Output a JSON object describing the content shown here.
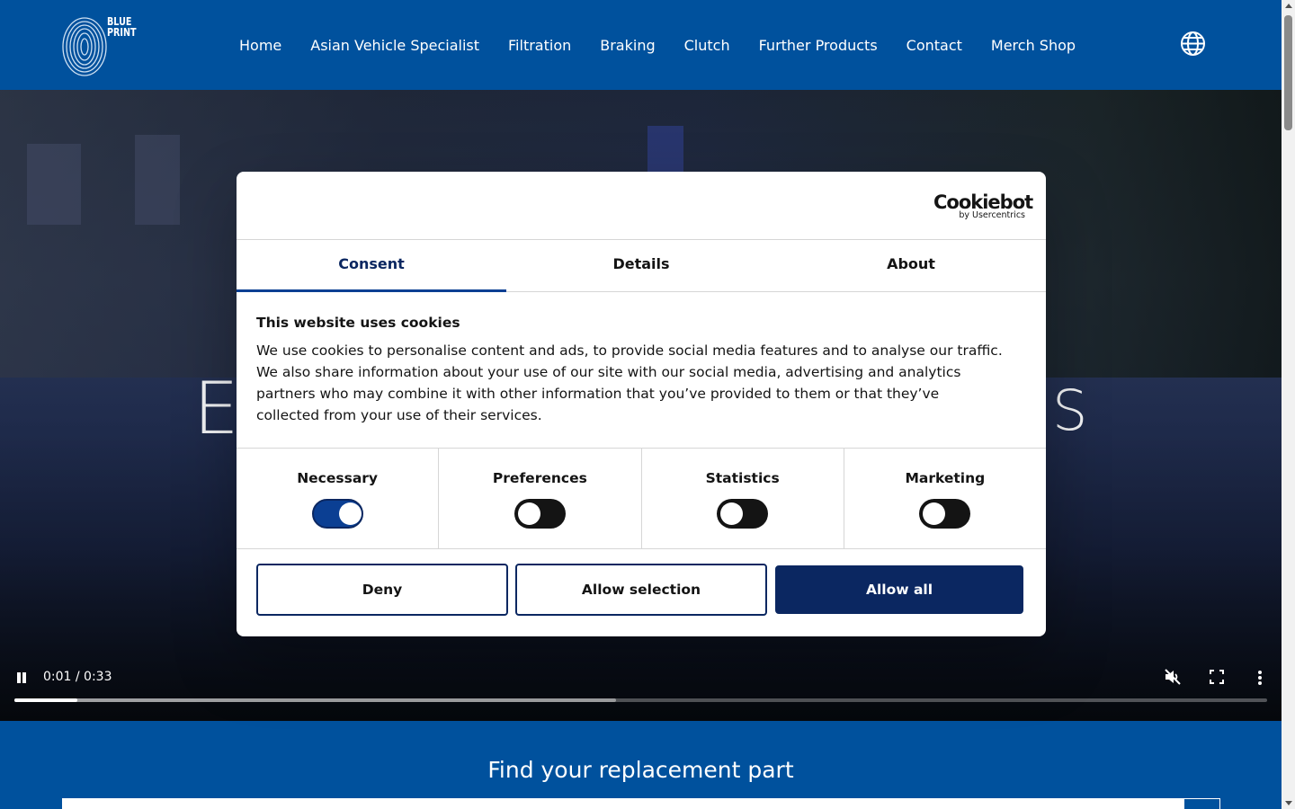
{
  "header": {
    "nav": [
      {
        "label": "Home"
      },
      {
        "label": "Asian Vehicle Specialist"
      },
      {
        "label": "Filtration"
      },
      {
        "label": "Braking"
      },
      {
        "label": "Clutch"
      },
      {
        "label": "Further Products"
      },
      {
        "label": "Contact"
      },
      {
        "label": "Merch Shop"
      }
    ],
    "logo_text": "BLUE PRINT",
    "icons": {
      "logo": "fingerprint-logo-icon",
      "language": "globe-icon"
    }
  },
  "hero": {
    "headline_left": "E",
    "headline_right": "S",
    "video": {
      "time": "0:01 / 0:33",
      "played_fraction": 0.05,
      "buffered_fraction": 0.48,
      "icons": {
        "pause": "pause-icon",
        "mute": "muted-icon",
        "fullscreen": "fullscreen-icon",
        "more": "more-vertical-icon"
      }
    }
  },
  "find": {
    "title": "Find your replacement part",
    "icons": {
      "search": "search-icon"
    }
  },
  "cookie_dialog": {
    "brand": {
      "name": "Cookiebot",
      "sub": "by Usercentrics"
    },
    "tabs": [
      {
        "label": "Consent",
        "active": true
      },
      {
        "label": "Details",
        "active": false
      },
      {
        "label": "About",
        "active": false
      }
    ],
    "title": "This website uses cookies",
    "description": "We use cookies to personalise content and ads, to provide social media features and to analyse our traffic. We also share information about your use of our site with our social media, advertising and analytics partners who may combine it with other information that you’ve provided to them or that they’ve collected from your use of their services.",
    "toggles": [
      {
        "label": "Necessary",
        "on": true
      },
      {
        "label": "Preferences",
        "on": false
      },
      {
        "label": "Statistics",
        "on": false
      },
      {
        "label": "Marketing",
        "on": false
      }
    ],
    "buttons": {
      "deny": "Deny",
      "allow_selection": "Allow selection",
      "allow_all": "Allow all"
    }
  },
  "colors": {
    "brand_blue": "#00519d",
    "dialog_navy": "#0b2761"
  }
}
